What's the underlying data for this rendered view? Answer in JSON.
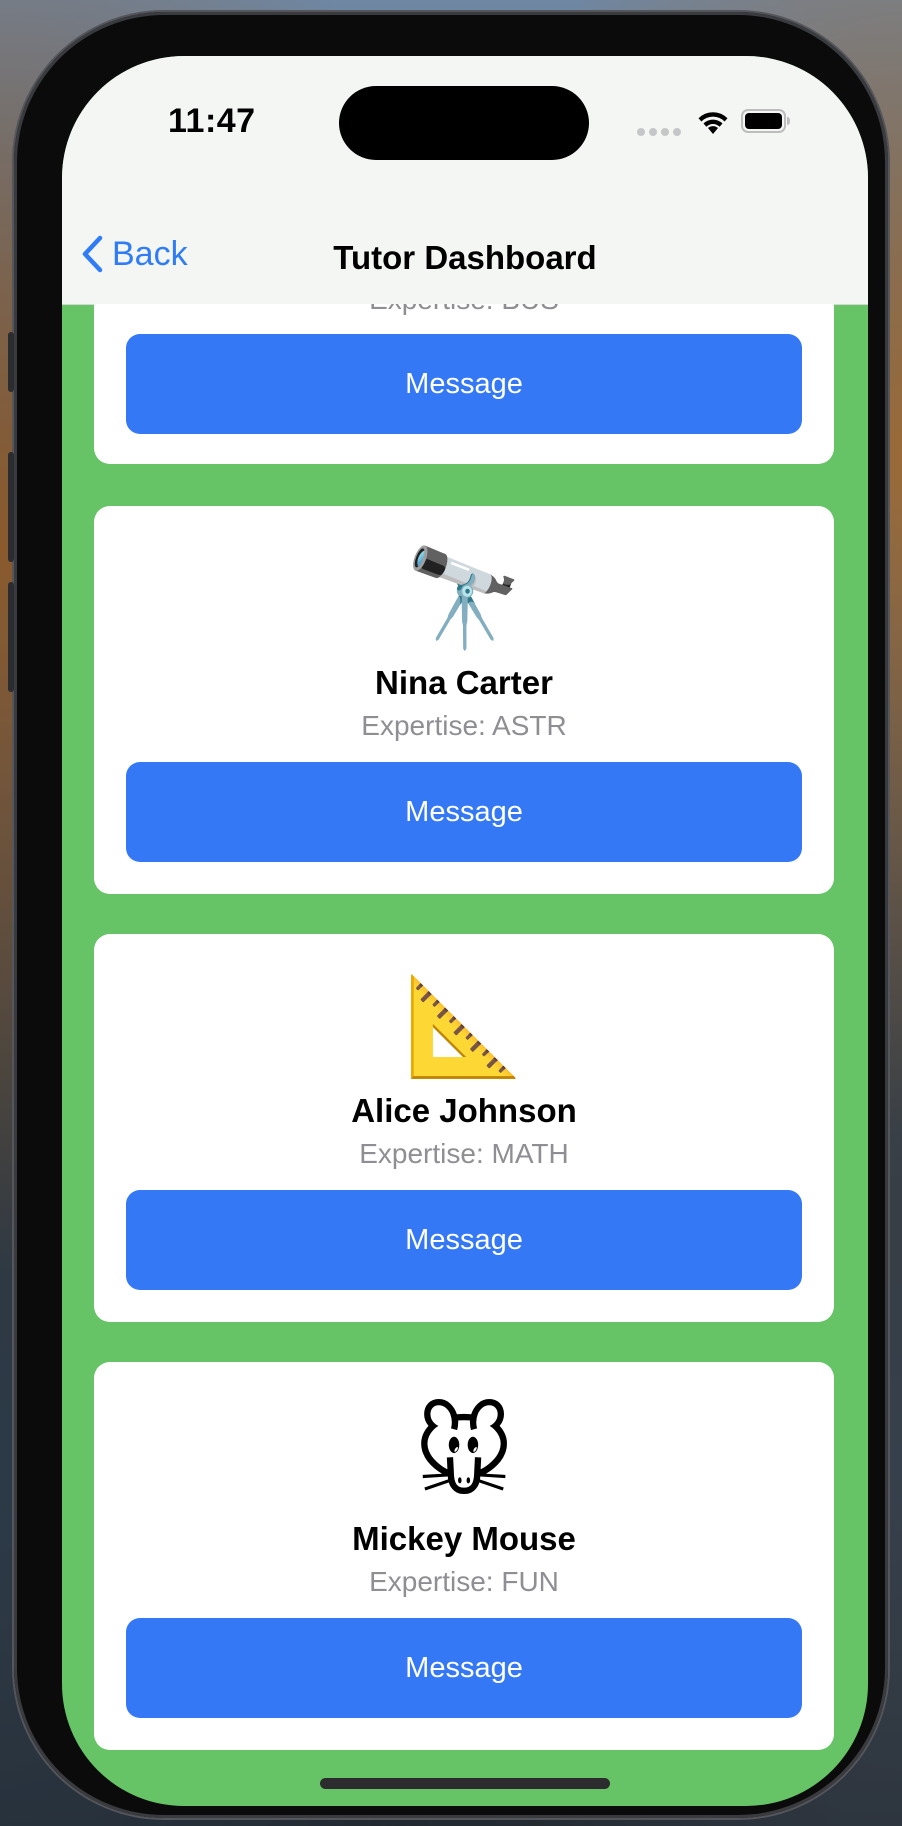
{
  "status_bar": {
    "time": "11:47"
  },
  "nav": {
    "back_label": "Back",
    "title": "Tutor Dashboard"
  },
  "tutors": [
    {
      "name": "",
      "expertise": "Expertise: BUS",
      "emoji": "",
      "message_label": "Message"
    },
    {
      "name": "Nina Carter",
      "expertise": "Expertise: ASTR",
      "emoji": "🔭",
      "message_label": "Message"
    },
    {
      "name": "Alice Johnson",
      "expertise": "Expertise: MATH",
      "emoji": "📐",
      "message_label": "Message"
    },
    {
      "name": "Mickey Mouse",
      "expertise": "Expertise: FUN",
      "emoji": "🐭",
      "message_label": "Message"
    }
  ],
  "colors": {
    "background": "#66c466",
    "accent": "#3478f6",
    "back_link": "#2f7cf6",
    "card": "#ffffff",
    "secondary_text": "#8e8e93"
  },
  "icons": {
    "back": "chevron-left-icon",
    "wifi": "wifi-icon",
    "battery": "battery-icon",
    "signal": "cellular-signal-icon"
  }
}
